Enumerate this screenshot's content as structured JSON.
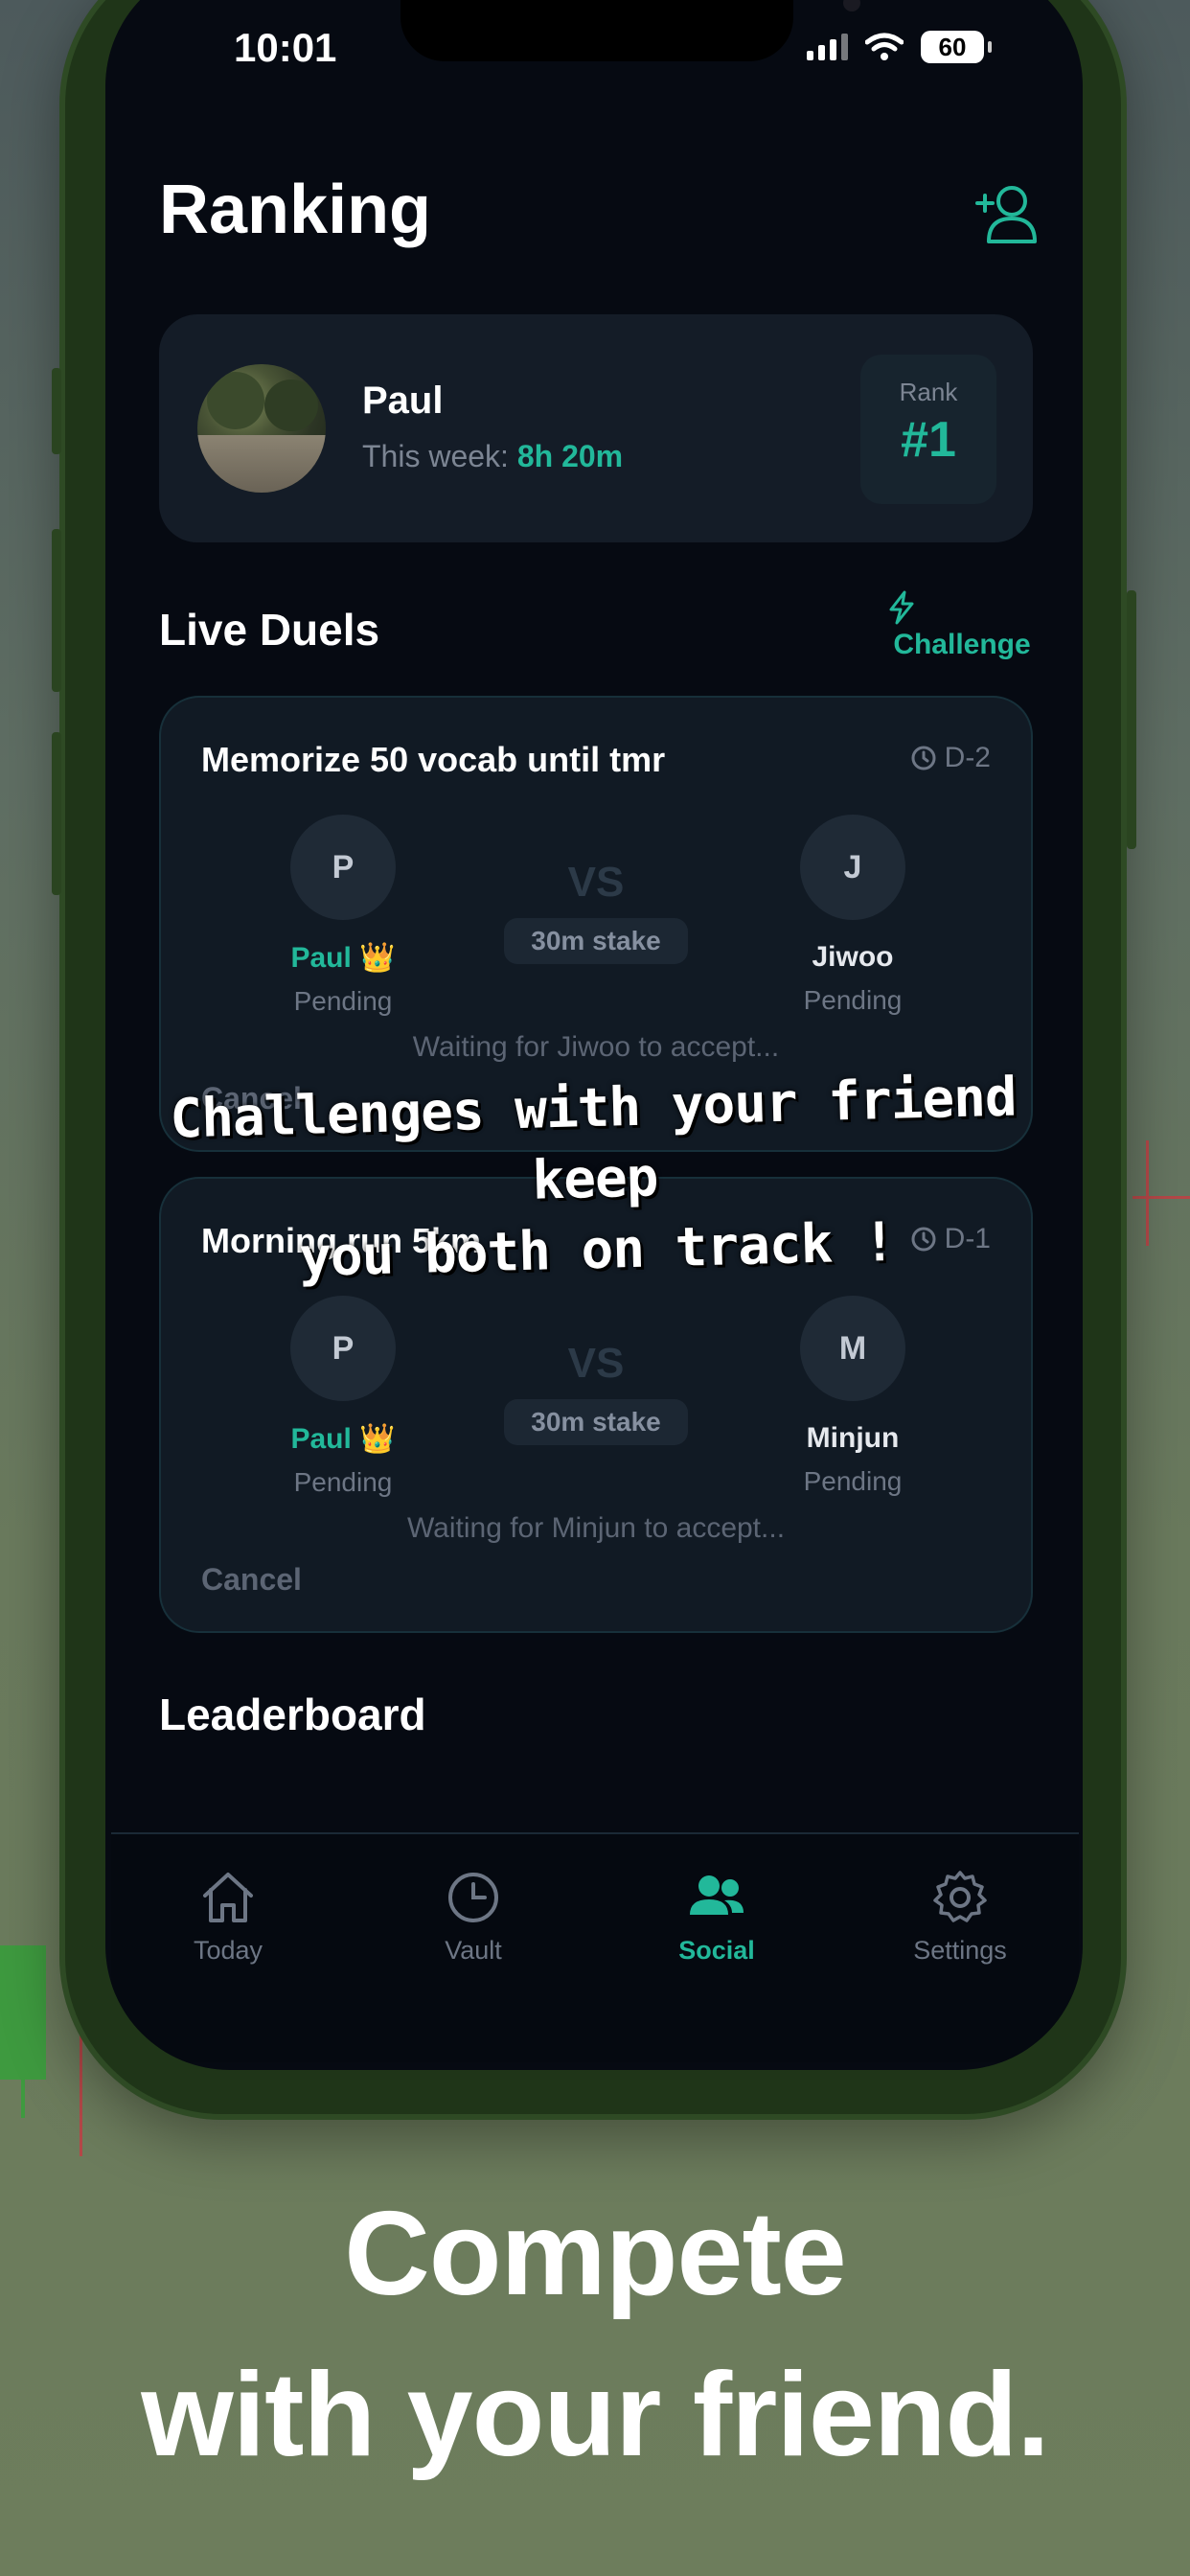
{
  "status_bar": {
    "time": "10:01",
    "battery": "60"
  },
  "header": {
    "title": "Ranking"
  },
  "profile": {
    "name": "Paul",
    "week_label": "This week: ",
    "week_value": "8h 20m",
    "rank_label": "Rank",
    "rank_value": "#1"
  },
  "live_duels": {
    "title": "Live Duels",
    "challenge_label": "Challenge",
    "duels": [
      {
        "title": "Memorize 50 vocab until tmr",
        "deadline": "D-2",
        "vs": "VS",
        "stake": "30m stake",
        "left": {
          "initial": "P",
          "name": "Paul 👑",
          "status": "Pending"
        },
        "right": {
          "initial": "J",
          "name": "Jiwoo",
          "status": "Pending"
        },
        "waiting": "Waiting for Jiwoo to accept...",
        "cancel": "Cancel"
      },
      {
        "title": "Morning run 5km",
        "deadline": "D-1",
        "vs": "VS",
        "stake": "30m stake",
        "left": {
          "initial": "P",
          "name": "Paul 👑",
          "status": "Pending"
        },
        "right": {
          "initial": "M",
          "name": "Minjun",
          "status": "Pending"
        },
        "waiting": "Waiting for Minjun to accept...",
        "cancel": "Cancel"
      }
    ]
  },
  "leaderboard": {
    "title": "Leaderboard"
  },
  "overlay_caption": {
    "line1": "Challenges with your friend keep",
    "line2": "you both on track !"
  },
  "tabbar": {
    "tabs": [
      {
        "label": "Today",
        "icon": "home-icon"
      },
      {
        "label": "Vault",
        "icon": "clock-icon"
      },
      {
        "label": "Social",
        "icon": "people-icon",
        "active": true
      },
      {
        "label": "Settings",
        "icon": "gear-icon"
      }
    ]
  },
  "headline": {
    "line1": "Compete",
    "line2": "with your friend."
  },
  "colors": {
    "accent": "#22b89a",
    "screen_bg": "#060a12",
    "card_bg": "#141c27",
    "phone_frame": "#1f3518"
  }
}
